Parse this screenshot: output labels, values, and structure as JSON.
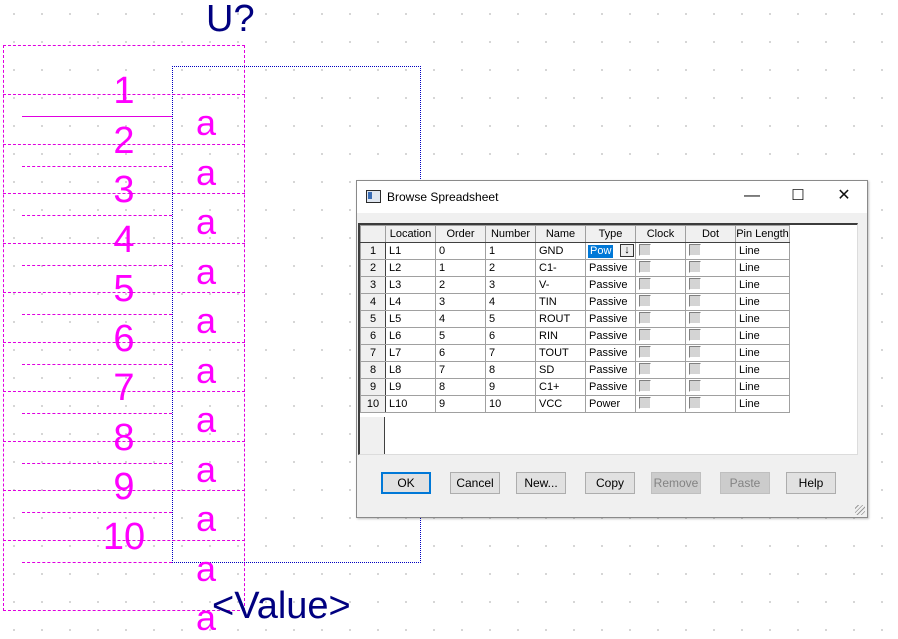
{
  "schematic": {
    "reference": "U?",
    "value": "<Value>",
    "pin_numbers": [
      "1",
      "2",
      "3",
      "4",
      "5",
      "6",
      "7",
      "8",
      "9",
      "10"
    ],
    "pin_names": [
      "a",
      "a",
      "a",
      "a",
      "a",
      "a",
      "a",
      "a",
      "a",
      "a",
      "a"
    ],
    "colors": {
      "reference": "#000080",
      "pins": "#ff00ff",
      "body_outline": "#0000c0"
    }
  },
  "dialog": {
    "title": "Browse Spreadsheet",
    "window_controls": {
      "minimize": "—",
      "maximize": "☐",
      "close": "✕"
    },
    "columns": [
      "Location",
      "Order",
      "Number",
      "Name",
      "Type",
      "Clock",
      "Dot",
      "Pin Length"
    ],
    "rows": [
      {
        "row": "1",
        "location": "L1",
        "order": "0",
        "number": "1",
        "name": "GND",
        "type": "Pow",
        "clock": false,
        "dot": false,
        "length": "Line"
      },
      {
        "row": "2",
        "location": "L2",
        "order": "1",
        "number": "2",
        "name": "C1-",
        "type": "Passive",
        "clock": false,
        "dot": false,
        "length": "Line"
      },
      {
        "row": "3",
        "location": "L3",
        "order": "2",
        "number": "3",
        "name": "V-",
        "type": "Passive",
        "clock": false,
        "dot": false,
        "length": "Line"
      },
      {
        "row": "4",
        "location": "L4",
        "order": "3",
        "number": "4",
        "name": "TIN",
        "type": "Passive",
        "clock": false,
        "dot": false,
        "length": "Line"
      },
      {
        "row": "5",
        "location": "L5",
        "order": "4",
        "number": "5",
        "name": "ROUT",
        "type": "Passive",
        "clock": false,
        "dot": false,
        "length": "Line"
      },
      {
        "row": "6",
        "location": "L6",
        "order": "5",
        "number": "6",
        "name": "RIN",
        "type": "Passive",
        "clock": false,
        "dot": false,
        "length": "Line"
      },
      {
        "row": "7",
        "location": "L7",
        "order": "6",
        "number": "7",
        "name": "TOUT",
        "type": "Passive",
        "clock": false,
        "dot": false,
        "length": "Line"
      },
      {
        "row": "8",
        "location": "L8",
        "order": "7",
        "number": "8",
        "name": "SD",
        "type": "Passive",
        "clock": false,
        "dot": false,
        "length": "Line"
      },
      {
        "row": "9",
        "location": "L9",
        "order": "8",
        "number": "9",
        "name": "C1+",
        "type": "Passive",
        "clock": false,
        "dot": false,
        "length": "Line"
      },
      {
        "row": "10",
        "location": "L10",
        "order": "9",
        "number": "10",
        "name": "VCC",
        "type": "Power",
        "clock": false,
        "dot": false,
        "length": "Line"
      }
    ],
    "editing_cell": {
      "row": "1",
      "column": "Type",
      "value": "Pow",
      "dropdown_icon": "arrow-down-icon"
    },
    "buttons": {
      "ok": "OK",
      "cancel": "Cancel",
      "new": "New...",
      "copy": "Copy",
      "remove": "Remove",
      "paste": "Paste",
      "help": "Help"
    },
    "disabled_buttons": [
      "remove",
      "paste"
    ]
  }
}
